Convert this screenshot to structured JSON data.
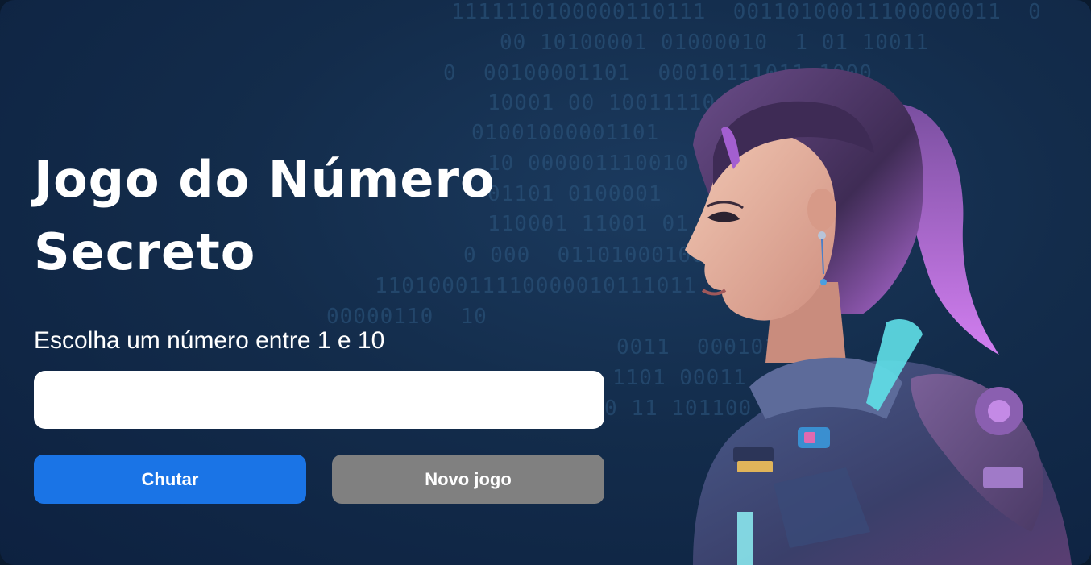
{
  "page": {
    "title": "Jogo do Número Secreto",
    "prompt": "Escolha um número entre 1 e 10",
    "input": {
      "value": "",
      "placeholder": ""
    },
    "buttons": {
      "guess_label": "Chutar",
      "new_game_label": "Novo jogo"
    }
  },
  "colors": {
    "background": "#132c4b",
    "guess_button": "#1a74e6",
    "new_game_button": "#808080",
    "text": "#ffffff"
  },
  "decorations": {
    "binary_rows": [
      "1111110100000110111  00110100011100000011  0",
      "00 10100001 01000010  1 01 10011",
      "0  00100001101  00010111011 1000",
      "10001 00 10011110",
      "01001000001101",
      "10 000001110010",
      "01101 0100001",
      "110001 11001 01",
      "0 000  01101000100",
      "110100011110000010111011",
      "00000110  10",
      "0011  000101101",
      "1101 00011",
      "0 11 101100"
    ],
    "illustration": "astronaut-woman-illustration"
  }
}
